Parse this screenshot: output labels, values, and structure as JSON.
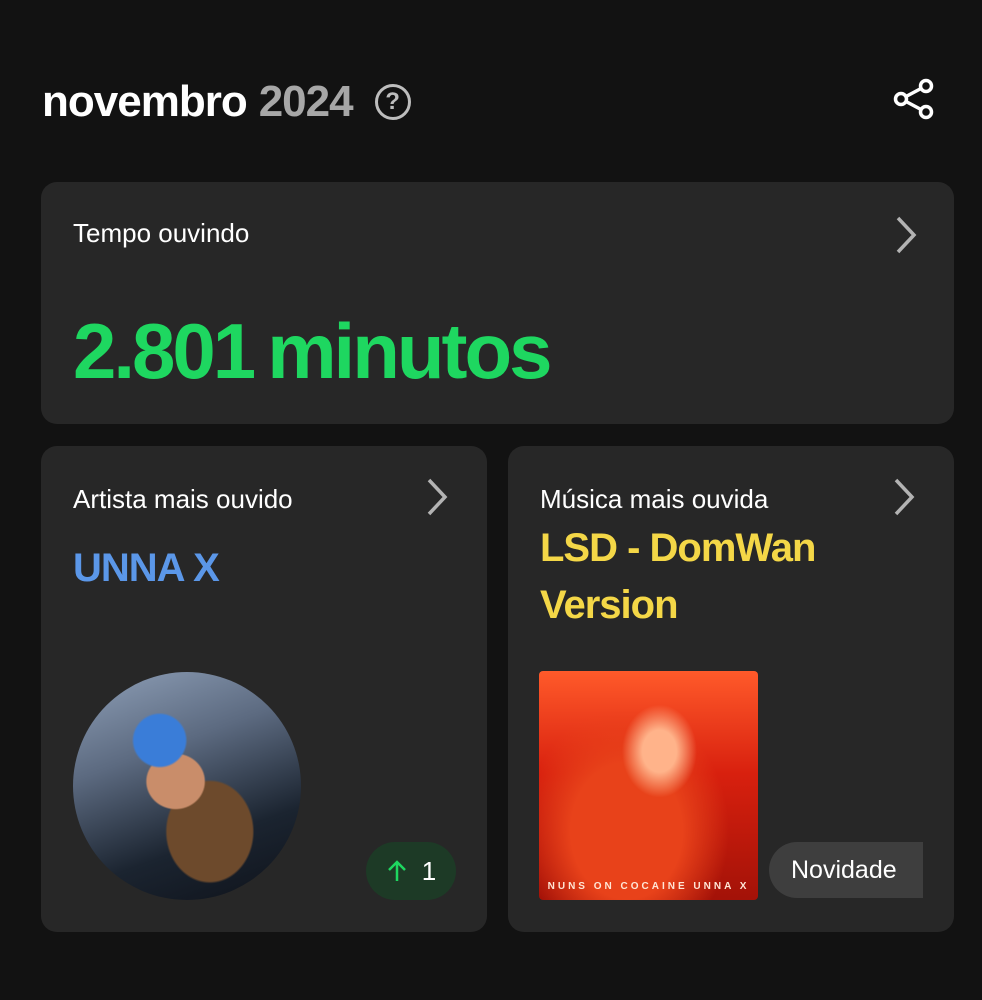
{
  "header": {
    "month": "novembro",
    "year": "2024",
    "help_glyph": "?",
    "help_icon": "help-circle-icon",
    "share_icon": "share-icon"
  },
  "listening_time": {
    "label": "Tempo ouvindo",
    "value": "2.801",
    "unit": "minutos",
    "color": "#1ed760"
  },
  "top_artist": {
    "label": "Artista mais ouvido",
    "name": "UNNA X",
    "name_color": "#5b97e8",
    "rank_change": "1",
    "rank_icon": "arrow-up-icon",
    "rank_color": "#1ed760"
  },
  "top_song": {
    "label": "Música mais ouvida",
    "title": "LSD - DomWan Version",
    "title_color": "#f4d747",
    "cover_text": "NUNS ON COCAINE UNNA X",
    "badge": "Novidade"
  },
  "colors": {
    "background": "#121212",
    "card": "#272727"
  }
}
